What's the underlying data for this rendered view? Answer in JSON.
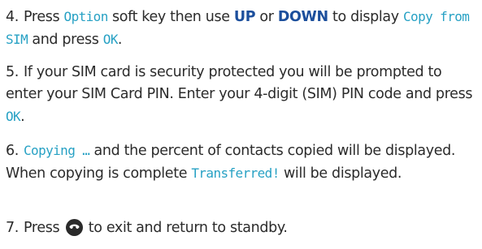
{
  "steps": [
    {
      "number": "4.",
      "parts": [
        {
          "type": "text",
          "value": "Press "
        },
        {
          "type": "lcd",
          "value": "Option"
        },
        {
          "type": "text",
          "value": " soft key then use "
        },
        {
          "type": "key",
          "value": "UP"
        },
        {
          "type": "text",
          "value": " or "
        },
        {
          "type": "key",
          "value": "DOWN"
        },
        {
          "type": "text",
          "value": " to display "
        },
        {
          "type": "lcd",
          "value": "Copy from SIM"
        },
        {
          "type": "text",
          "value": " and press "
        },
        {
          "type": "lcd",
          "value": "OK"
        },
        {
          "type": "text",
          "value": "."
        }
      ]
    },
    {
      "number": "5.",
      "parts": [
        {
          "type": "text",
          "value": "If your SIM card is security protected you will be prompted to enter your SIM Card PIN. Enter your 4-digit (SIM) PIN code and press "
        },
        {
          "type": "lcd",
          "value": "OK"
        },
        {
          "type": "text",
          "value": "."
        }
      ]
    },
    {
      "number": "6.",
      "parts": [
        {
          "type": "lcd",
          "value": "Copying …"
        },
        {
          "type": "text",
          "value": " and the percent of contacts copied will be displayed. When copying is complete "
        },
        {
          "type": "lcd",
          "value": "Transferred!"
        },
        {
          "type": "text",
          "value": " will be displayed."
        }
      ]
    },
    {
      "number": "7.",
      "parts": [
        {
          "type": "text",
          "value": "Press "
        },
        {
          "type": "icon",
          "name": "end-call-key-icon"
        },
        {
          "type": "text",
          "value": " to exit and return to standby."
        }
      ]
    }
  ],
  "colors": {
    "text": "#2b2b2b",
    "lcd_text": "#27a1c4",
    "key_text": "#1c4f9c",
    "icon_fill": "#2a2a2a"
  }
}
